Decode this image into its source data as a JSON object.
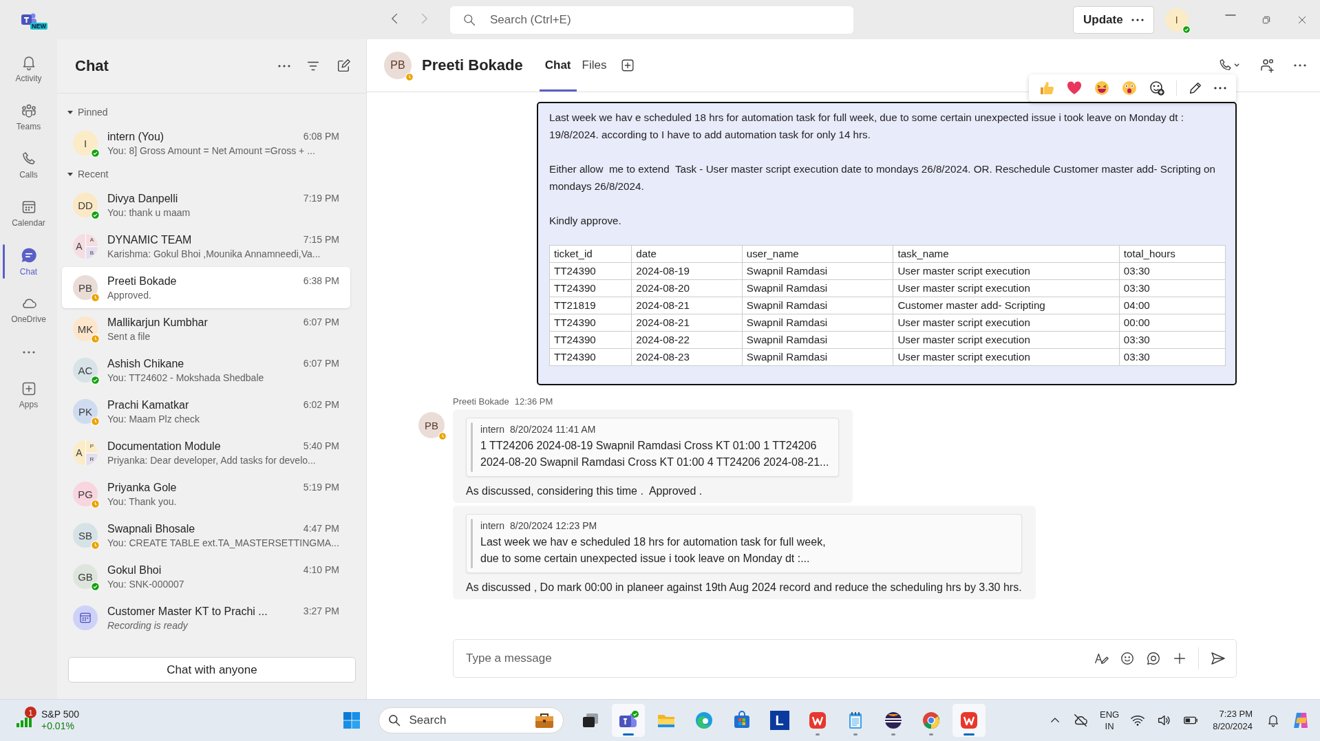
{
  "title_bar": {
    "app_badge": "NEW",
    "search": {
      "placeholder": "Search (Ctrl+E)"
    },
    "update_button": "Update",
    "user": {
      "initials": "I",
      "online": true
    }
  },
  "rail": [
    {
      "label": "Activity",
      "kind": "bell",
      "selected": false
    },
    {
      "label": "Teams",
      "kind": "teams",
      "selected": false
    },
    {
      "label": "Calls",
      "kind": "phone",
      "selected": false
    },
    {
      "label": "Calendar",
      "kind": "calendar",
      "selected": false
    },
    {
      "label": "Chat",
      "kind": "chat",
      "selected": true
    },
    {
      "label": "OneDrive",
      "kind": "cloud",
      "selected": false
    }
  ],
  "rail_extra": [
    {
      "label": "Apps",
      "kind": "apps",
      "selected": false
    }
  ],
  "chat_list": {
    "title": "Chat",
    "sections": [
      {
        "label": "Pinned",
        "expanded": true,
        "items": [
          {
            "kind": "person",
            "name": "intern (You)",
            "time": "6:08 PM",
            "preview": "You: 8] Gross Amount = Net Amount =Gross + ...",
            "initials": "I",
            "color": "#fbecc7",
            "online": true,
            "selected": false
          }
        ]
      },
      {
        "label": "Recent",
        "expanded": true,
        "items": [
          {
            "kind": "person",
            "name": "Divya Danpelli",
            "time": "7:19 PM",
            "preview": "You: thank u maam",
            "initials": "DD",
            "color": "#fbe8c4",
            "online": true,
            "selected": false
          },
          {
            "kind": "group",
            "name": "DYNAMIC TEAM",
            "time": "7:15 PM",
            "preview": "Karishma: Gokul Bhoi ,Mounika Annamneedi,Va...",
            "initials": "A",
            "sub_initials": [
              "A",
              "B"
            ],
            "color": "#f5dde2",
            "selected": false
          },
          {
            "kind": "person",
            "name": "Preeti Bokade",
            "time": "6:38 PM",
            "preview": "Approved.",
            "initials": "PB",
            "color": "#eadcd6",
            "online": false,
            "selected": true
          },
          {
            "kind": "person",
            "name": "Mallikarjun Kumbhar",
            "time": "6:07 PM",
            "preview": "Sent a file",
            "initials": "MK",
            "color": "#fde6cc",
            "online": false,
            "selected": false
          },
          {
            "kind": "person",
            "name": "Ashish Chikane",
            "time": "6:07 PM",
            "preview": "You: TT24602 - Mokshada Shedbale",
            "initials": "AC",
            "color": "#d8e3e8",
            "online": true,
            "selected": false
          },
          {
            "kind": "person",
            "name": "Prachi Kamatkar",
            "time": "6:02 PM",
            "preview": "You: Maam Plz check",
            "initials": "PK",
            "color": "#cfdcf0",
            "online": false,
            "selected": false
          },
          {
            "kind": "group",
            "name": "Documentation Module",
            "time": "5:40 PM",
            "preview": "Priyanka: Dear developer, Add tasks for develo...",
            "initials": "A",
            "sub_initials": [
              "P",
              "R"
            ],
            "color": "#fbecc7",
            "selected": false
          },
          {
            "kind": "person",
            "name": "Priyanka Gole",
            "time": "5:19 PM",
            "preview": "You: Thank you.",
            "initials": "PG",
            "color": "#f8d5df",
            "online": false,
            "selected": false
          },
          {
            "kind": "person",
            "name": "Swapnali Bhosale",
            "time": "4:47 PM",
            "preview": "You: CREATE TABLE ext.TA_MASTERSETTINGMA...",
            "initials": "SB",
            "color": "#d5e2e6",
            "online": false,
            "selected": false
          },
          {
            "kind": "person",
            "name": "Gokul Bhoi",
            "time": "4:10 PM",
            "preview": "You: SNK-000007",
            "initials": "GB",
            "color": "#dee5dc",
            "online": true,
            "selected": false
          },
          {
            "kind": "meeting",
            "name": "Customer Master KT to Prachi ...",
            "time": "3:27 PM",
            "preview": "Recording is ready",
            "color": "#cfd2f8",
            "selected": false
          }
        ]
      }
    ],
    "new_chat_button": "Chat with anyone"
  },
  "conversation": {
    "header": {
      "name": "Preeti Bokade",
      "initials": "PB",
      "online": false,
      "tabs": [
        {
          "label": "Chat",
          "selected": true
        },
        {
          "label": "Files",
          "selected": false
        }
      ]
    },
    "own_message": {
      "paragraphs": [
        "Last week we hav e scheduled 18 hrs for automation task for full week, due to some certain unexpected issue i took leave on Monday dt : 19/8/2024. according to I have to add automation task for only 14 hrs.",
        "Either allow  me to extend  Task - User master script execution date to mondays 26/8/2024. OR. Reschedule Customer master add- Scripting on mondays 26/8/2024.",
        "Kindly approve."
      ],
      "table": {
        "columns": [
          "ticket_id",
          "date",
          "user_name",
          "task_name",
          "total_hours"
        ],
        "rows": [
          [
            "TT24390",
            "2024-08-19",
            "Swapnil Ramdasi",
            "User master script execution",
            "03:30"
          ],
          [
            "TT24390",
            "2024-08-20",
            "Swapnil Ramdasi",
            "User master script execution",
            "03:30"
          ],
          [
            "TT21819",
            "2024-08-21",
            "Swapnil Ramdasi",
            "Customer master add- Scripting",
            "04:00"
          ],
          [
            "TT24390",
            "2024-08-21",
            "Swapnil Ramdasi",
            "User master script execution",
            "00:00"
          ],
          [
            "TT24390",
            "2024-08-22",
            "Swapnil Ramdasi",
            "User master script execution",
            "03:30"
          ],
          [
            "TT24390",
            "2024-08-23",
            "Swapnil Ramdasi",
            "User master script execution",
            "03:30"
          ]
        ]
      }
    },
    "sender": {
      "name": "Preeti Bokade",
      "time": "12:36 PM",
      "initials": "PB",
      "online": false
    },
    "replies": [
      {
        "quote": {
          "author": "intern",
          "time": "8/20/2024 11:41 AM",
          "lines": [
            "1 TT24206 2024-08-19 Swapnil Ramdasi Cross KT 01:00 1 TT24206",
            "2024-08-20 Swapnil Ramdasi Cross KT 01:00 4 TT24206 2024-08-21..."
          ]
        },
        "text": "As discussed, considering this time .  Approved ."
      },
      {
        "quote": {
          "author": "intern",
          "time": "8/20/2024 12:23 PM",
          "lines": [
            "Last week we hav e scheduled 18 hrs for automation task for full week,",
            "due to some certain unexpected issue i took leave on Monday dt :..."
          ]
        },
        "text": "As discussed , Do mark 00:00 in planeer against 19th Aug 2024 record and reduce the scheduling hrs by 3.30 hrs."
      }
    ],
    "composer": {
      "placeholder": "Type a message"
    }
  },
  "taskbar": {
    "widget": {
      "badge": "1",
      "label": "S&P 500",
      "change": "+0.01%"
    },
    "search": "Search",
    "apps": [
      {
        "kind": "task-view",
        "running": false,
        "active": false
      },
      {
        "kind": "teams",
        "running": true,
        "active": true
      },
      {
        "kind": "file-explorer",
        "running": false,
        "active": false
      },
      {
        "kind": "edge",
        "running": false,
        "active": false
      },
      {
        "kind": "store",
        "running": false,
        "active": false
      },
      {
        "kind": "tile",
        "label": "L",
        "running": false,
        "active": false
      },
      {
        "kind": "wps",
        "running": true,
        "active": false
      },
      {
        "kind": "notepad",
        "running": true,
        "active": false
      },
      {
        "kind": "eclipse",
        "running": true,
        "active": false
      },
      {
        "kind": "chrome",
        "running": true,
        "active": false
      },
      {
        "kind": "wps",
        "running": true,
        "active": true
      }
    ],
    "tray": {
      "language": "ENG",
      "region": "IN",
      "time": "7:23 PM",
      "date": "8/20/2024"
    }
  }
}
